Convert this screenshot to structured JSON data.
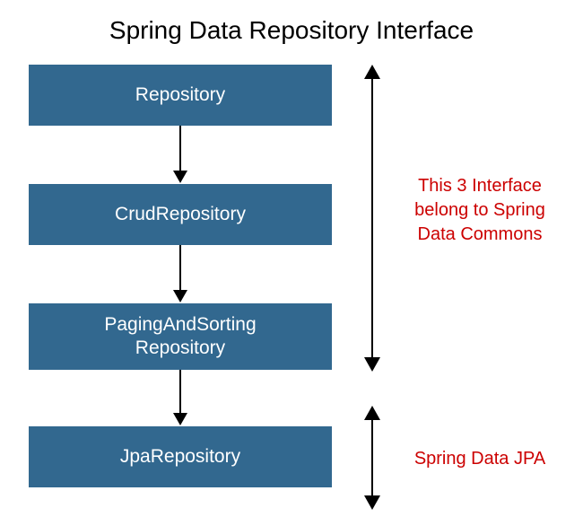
{
  "title": "Spring Data Repository Interface",
  "boxes": {
    "b1": "Repository",
    "b2": "CrudRepository",
    "b3_line1": "PagingAndSorting",
    "b3_line2": "Repository",
    "b4": "JpaRepository"
  },
  "annotations": {
    "group1_line1": "This 3 Interface",
    "group1_line2": "belong to Spring",
    "group1_line3": "Data Commons",
    "group2": "Spring Data JPA"
  },
  "colors": {
    "box_bg": "#32688f",
    "box_text": "#ffffff",
    "annotation_text": "#cc0000",
    "arrow": "#000000"
  }
}
